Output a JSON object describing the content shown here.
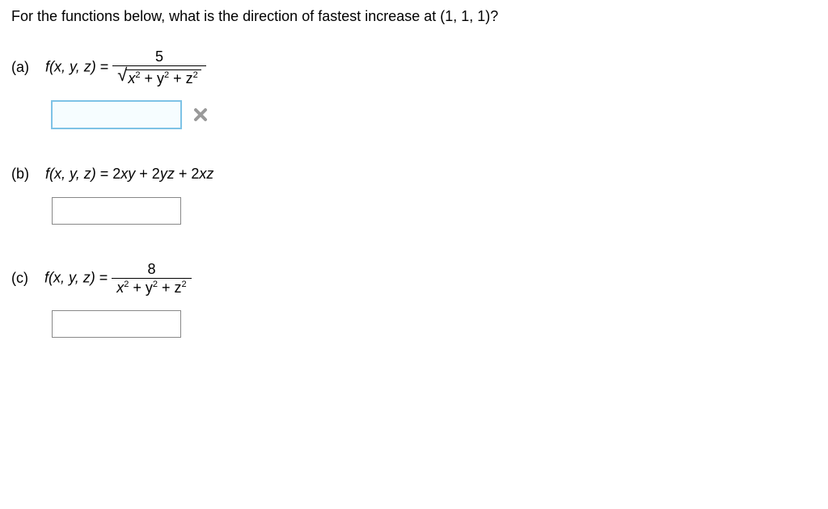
{
  "question": "For the functions below, what is the direction of fastest increase at (1, 1, 1)?",
  "parts": {
    "a": {
      "label": "(a)",
      "lhs": "f(x, y, z) = ",
      "numerator": "5",
      "radicand_prefix": "x",
      "radicand_mid1": " + y",
      "radicand_mid2": " + z",
      "exp": "2",
      "answer_value": "",
      "status": "incorrect"
    },
    "b": {
      "label": "(b)",
      "lhs": "f(x, y, z) = ",
      "rhs": "2xy + 2yz + 2xz",
      "answer_value": ""
    },
    "c": {
      "label": "(c)",
      "lhs": "f(x, y, z) = ",
      "numerator": "8",
      "den_prefix": "x",
      "den_mid1": " + y",
      "den_mid2": " + z",
      "exp": "2",
      "answer_value": ""
    }
  }
}
